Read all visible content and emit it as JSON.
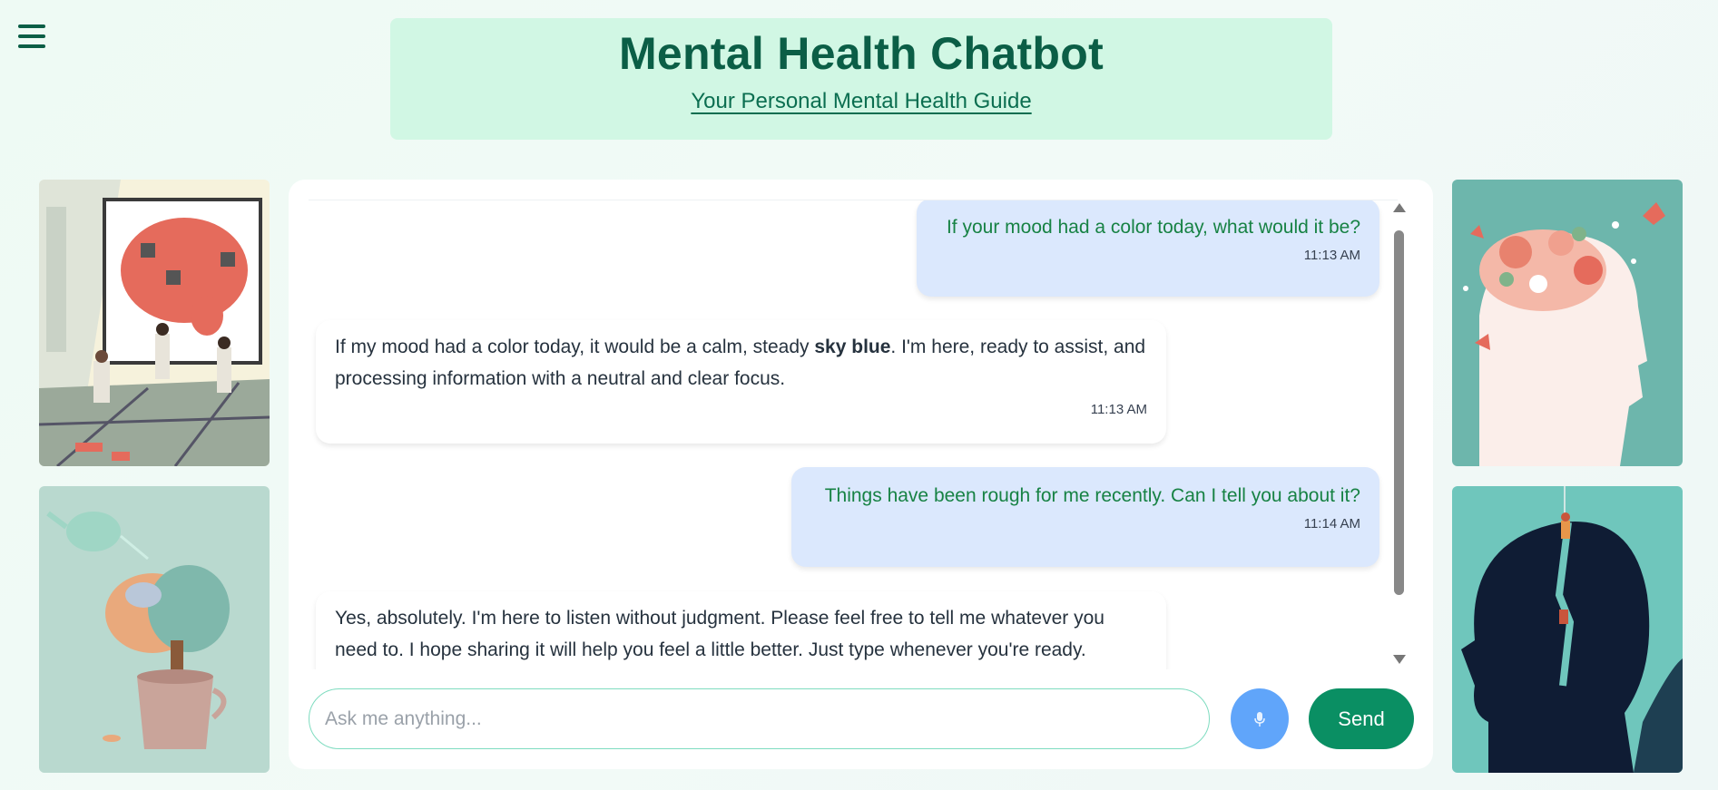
{
  "header": {
    "title": "Mental Health Chatbot",
    "subtitle": "Your Personal Mental Health Guide"
  },
  "icons": {
    "menu": "hamburger-menu-icon",
    "mic": "microphone-icon",
    "scroll_up": "triangle-up-icon",
    "scroll_down": "triangle-down-icon"
  },
  "colors": {
    "brand": "#0b5e46",
    "header_bg": "#d1f7e4",
    "user_bubble": "#dbe8fd",
    "user_text": "#178244",
    "send_button": "#0a8f63",
    "mic_button": "#60a5fa"
  },
  "messages": [
    {
      "role": "user",
      "text": "If your mood had a color today, what would it be?",
      "time": "11:13 AM"
    },
    {
      "role": "bot",
      "text_before": "If my mood had a color today, it would be a calm, steady ",
      "text_bold": "sky blue",
      "text_after": ". I'm here, ready to assist, and processing information with a neutral and clear focus.",
      "time": "11:13 AM"
    },
    {
      "role": "user",
      "text": "Things have been rough for me recently. Can I tell you about it?",
      "time": "11:14 AM"
    },
    {
      "role": "bot",
      "text": "Yes, absolutely. I'm here to listen without judgment. Please feel free to tell me whatever you need to. I hope sharing it will help you feel a little better. Just type whenever you're ready."
    }
  ],
  "composer": {
    "placeholder": "Ask me anything...",
    "value": "",
    "send_label": "Send"
  },
  "side_images": {
    "left_top": "brain-puzzle-illustration",
    "left_bottom": "brain-plant-illustration",
    "right_top": "flower-head-illustration",
    "right_bottom": "climber-head-silhouette-illustration"
  }
}
